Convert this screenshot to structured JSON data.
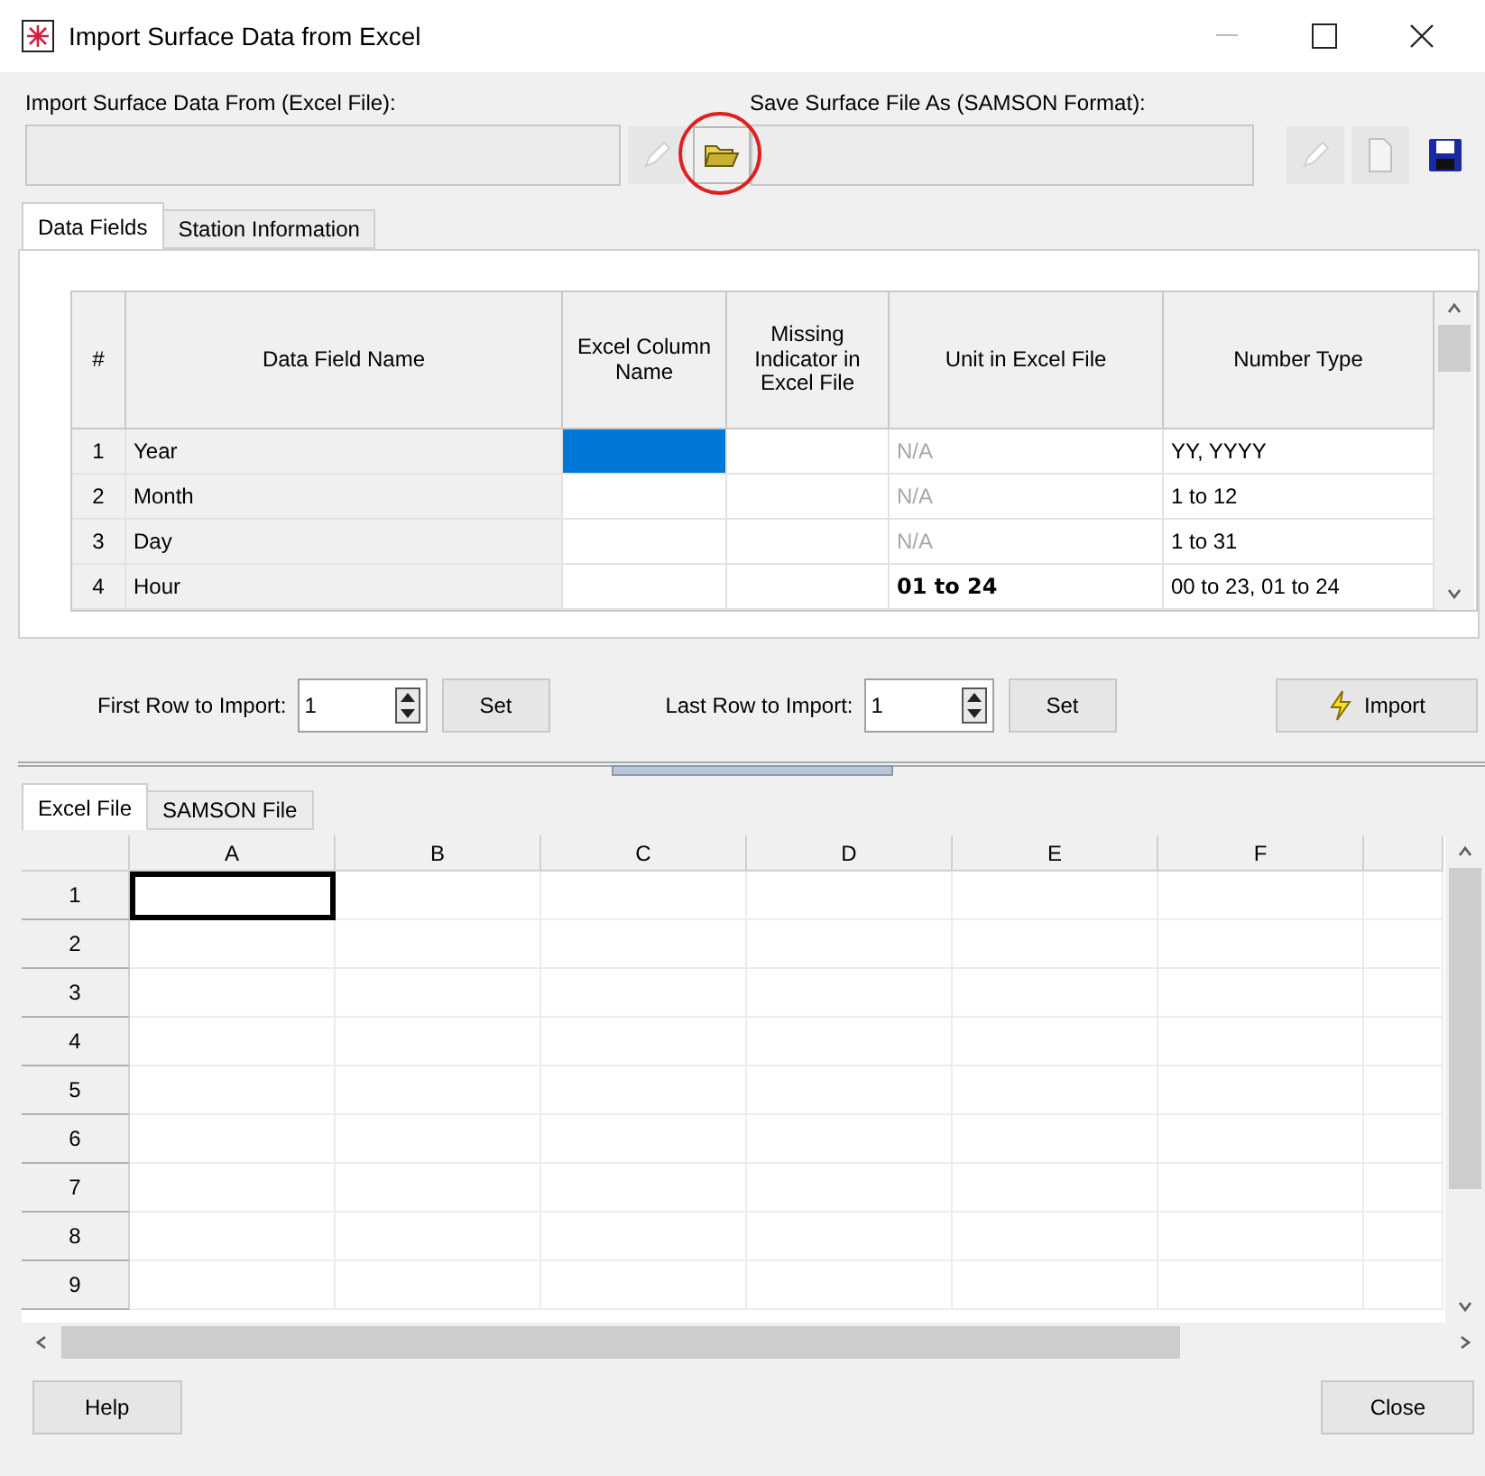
{
  "window": {
    "title": "Import Surface Data from Excel"
  },
  "source": {
    "label": "Import Surface Data From (Excel File):",
    "open_highlighted": true
  },
  "target": {
    "label": "Save Surface File As (SAMSON Format):"
  },
  "top_tabs": [
    {
      "label": "Data Fields",
      "selected": true
    },
    {
      "label": "Station Information",
      "selected": false
    }
  ],
  "fields_table": {
    "columns": [
      "#",
      "Data Field Name",
      "Excel Column Name",
      "Missing Indicator in Excel File",
      "Unit in Excel File",
      "Number Type"
    ],
    "rows": [
      {
        "number": "1",
        "name": "Year",
        "excel_selected": true,
        "unit": "N/A",
        "unit_disabled": true,
        "unit_bold": false,
        "number_type": "YY, YYYY"
      },
      {
        "number": "2",
        "name": "Month",
        "excel_selected": false,
        "unit": "N/A",
        "unit_disabled": true,
        "unit_bold": false,
        "number_type": "1 to 12"
      },
      {
        "number": "3",
        "name": "Day",
        "excel_selected": false,
        "unit": "N/A",
        "unit_disabled": true,
        "unit_bold": false,
        "number_type": "1 to 31"
      },
      {
        "number": "4",
        "name": "Hour",
        "excel_selected": false,
        "unit": "01 to 24",
        "unit_disabled": false,
        "unit_bold": true,
        "number_type": "00 to 23, 01 to 24"
      }
    ]
  },
  "first_row": {
    "label": "First Row to Import:",
    "value": "1",
    "button": "Set"
  },
  "last_row": {
    "label": "Last Row to Import:",
    "value": "1",
    "button": "Set"
  },
  "import_button": "Import",
  "bottom_tabs": [
    {
      "label": "Excel File",
      "selected": true
    },
    {
      "label": "SAMSON File",
      "selected": false
    }
  ],
  "sheet": {
    "columns": [
      "A",
      "B",
      "C",
      "D",
      "E",
      "F"
    ],
    "rows": [
      "1",
      "2",
      "3",
      "4",
      "5",
      "6",
      "7",
      "8",
      "9"
    ]
  },
  "buttons": {
    "help": "Help",
    "close": "Close"
  }
}
